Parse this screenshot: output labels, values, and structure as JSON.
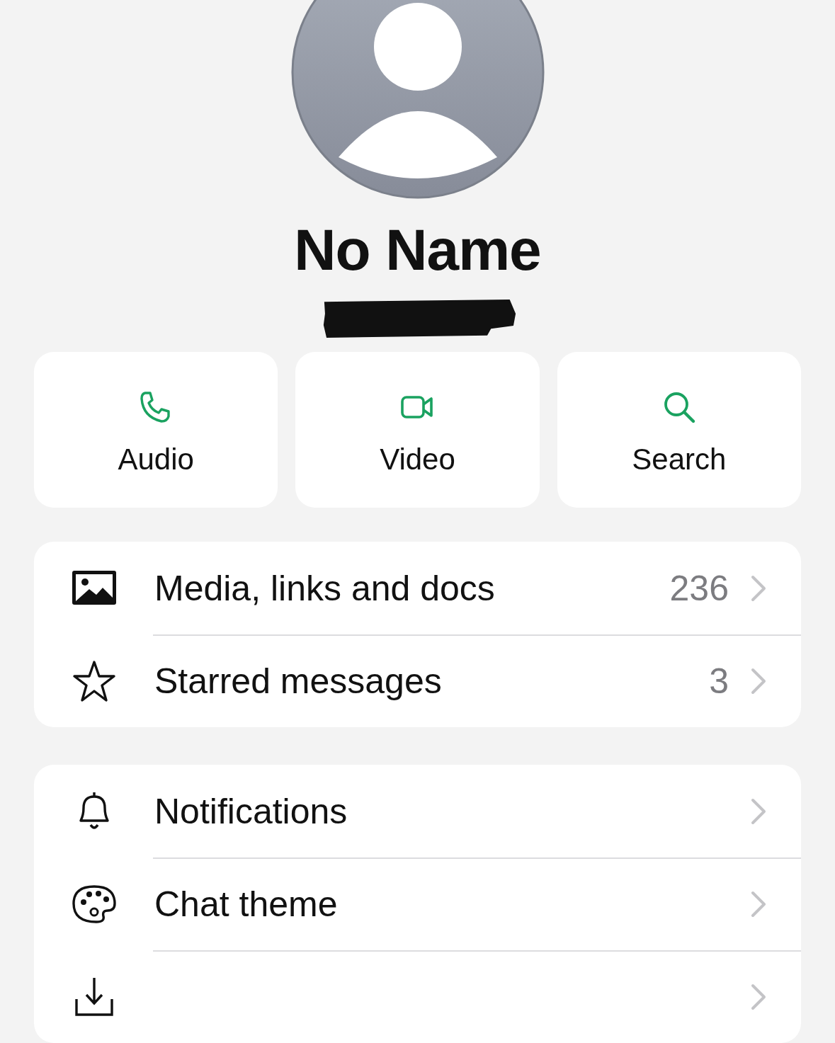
{
  "contact": {
    "name": "No Name",
    "number_redacted": true
  },
  "actions": [
    {
      "kind": "audio",
      "label": "Audio"
    },
    {
      "kind": "video",
      "label": "Video"
    },
    {
      "kind": "search",
      "label": "Search"
    }
  ],
  "groups": [
    {
      "rows": [
        {
          "kind": "media",
          "label": "Media, links and docs",
          "value": "236"
        },
        {
          "kind": "starred",
          "label": "Starred messages",
          "value": "3"
        }
      ]
    },
    {
      "rows": [
        {
          "kind": "notifications",
          "label": "Notifications"
        },
        {
          "kind": "theme",
          "label": "Chat theme"
        },
        {
          "kind": "save"
        }
      ]
    }
  ]
}
